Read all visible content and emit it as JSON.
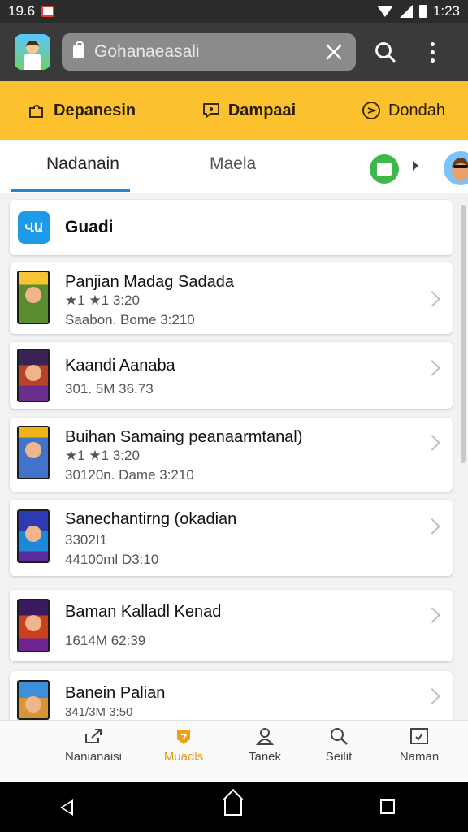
{
  "status_bar": {
    "time_left": "19.6",
    "time_right": "1:23"
  },
  "app_bar": {
    "search_value": "Gohanaeasali"
  },
  "categories": [
    {
      "label": "Depanesin",
      "icon": "puzzle-icon"
    },
    {
      "label": "Dampaai",
      "icon": "chat-icon"
    },
    {
      "label": "Dondah",
      "icon": "pointer-icon"
    }
  ],
  "tabs": [
    {
      "label": "Nadanain",
      "active": true
    },
    {
      "label": "Maela",
      "active": false
    }
  ],
  "section": {
    "title": "Guadi",
    "icon_text": "ՎԱ"
  },
  "games": [
    {
      "title": "Panjian Madag Sadada",
      "line1": "★1 ★1  3:20",
      "line2": "Saabon. Bome  3:210"
    },
    {
      "title": "Kaandi Aanaba",
      "line1": "301. 5M  36.73",
      "line2": ""
    },
    {
      "title": "Buihan Samaing peanaarmtanal)",
      "line1": "★1 ★1  3:20",
      "line2": "30120n. Dame  3:210"
    },
    {
      "title": "Sanechantirng (okadian",
      "line1": "3302I1",
      "line2": "44100ml  D3:10"
    },
    {
      "title": "Baman Kalladl Kenad",
      "line1": "1614M  62:39",
      "line2": ""
    },
    {
      "title": "Banein Palian",
      "line1": "341/3M  3:50",
      "line2": ""
    }
  ],
  "bottom_nav": [
    {
      "label": "Nanianaisi",
      "icon": "share-icon",
      "active": false
    },
    {
      "label": "Muadls",
      "icon": "tag-icon",
      "active": true
    },
    {
      "label": "Tanek",
      "icon": "person-icon",
      "active": false
    },
    {
      "label": "Seilit",
      "icon": "magnifier-icon",
      "active": false
    },
    {
      "label": "Naman",
      "icon": "calendar-icon",
      "active": false
    }
  ],
  "colors": {
    "accent": "#fcc12f",
    "tab_underline": "#1f86d8",
    "active_nav": "#e79a12"
  }
}
